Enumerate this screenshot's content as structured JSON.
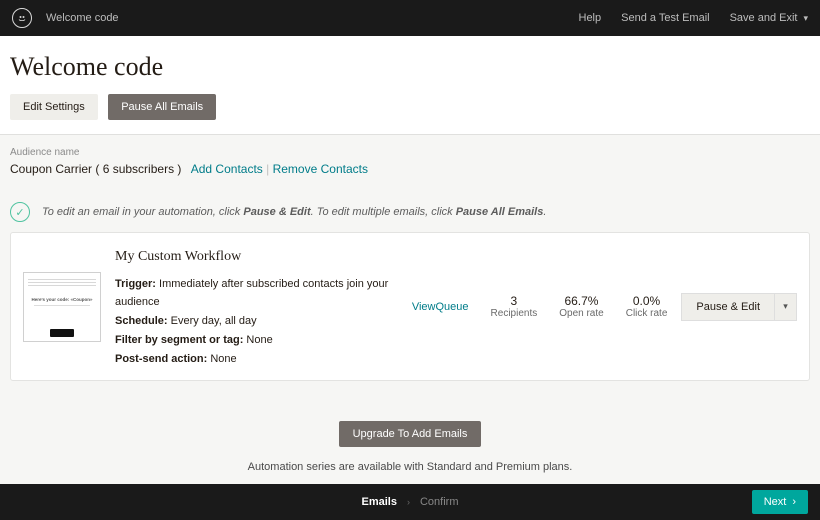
{
  "topbar": {
    "breadcrumb": "Welcome code",
    "help": "Help",
    "send_test": "Send a Test Email",
    "save_exit": "Save and Exit"
  },
  "header": {
    "title": "Welcome code",
    "edit_settings": "Edit Settings",
    "pause_all": "Pause All Emails"
  },
  "audience": {
    "label": "Audience name",
    "name": "Coupon Carrier ( 6 subscribers )",
    "add": "Add Contacts",
    "remove": "Remove Contacts"
  },
  "tip": {
    "pre": "To edit an email in your automation, click ",
    "b1": "Pause & Edit",
    "mid": ". To edit multiple emails, click ",
    "b2": "Pause All Emails",
    "post": "."
  },
  "workflow": {
    "title": "My Custom Workflow",
    "trigger_label": "Trigger:",
    "trigger_value": " Immediately after subscribed contacts join your audience",
    "schedule_label": "Schedule:",
    "schedule_value": " Every day, all day",
    "filter_label": "Filter by segment or tag:",
    "filter_value": " None",
    "post_label": "Post-send action:",
    "post_value": " None",
    "thumb_text": "Here's your code: «Coupon»"
  },
  "stats": {
    "view": "View",
    "queue": "Queue",
    "recipients_n": "3",
    "recipients_l": "Recipients",
    "open_n": "66.7%",
    "open_l": "Open rate",
    "click_n": "0.0%",
    "click_l": "Click rate"
  },
  "actions": {
    "pause_edit": "Pause & Edit"
  },
  "upgrade": {
    "btn": "Upgrade To Add Emails",
    "note": "Automation series are available with Standard and Premium plans."
  },
  "footer": {
    "step1": "Emails",
    "step2": "Confirm",
    "next": "Next"
  }
}
